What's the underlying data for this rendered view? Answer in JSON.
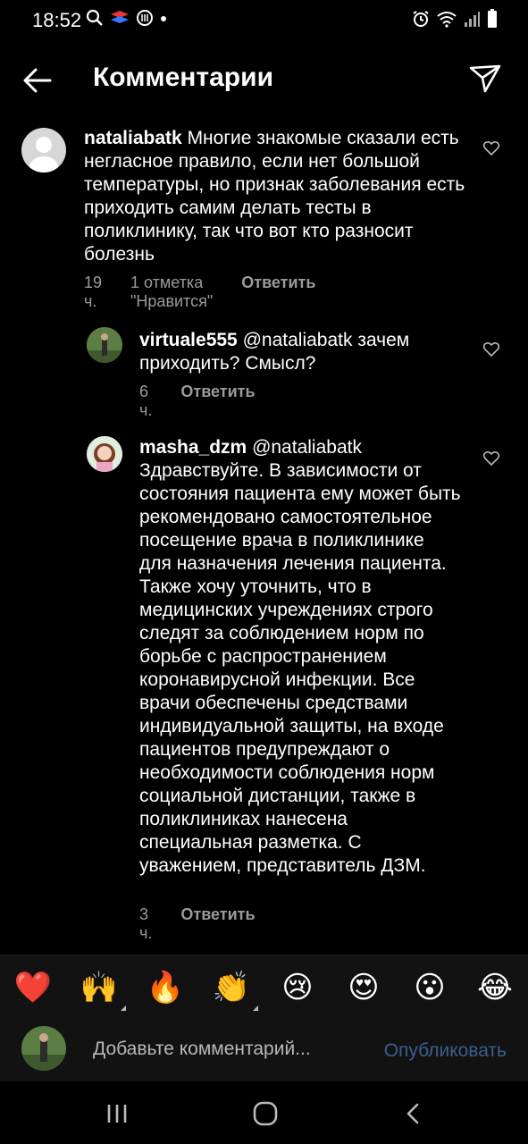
{
  "status": {
    "time": "18:52",
    "icons_left": [
      "search-icon",
      "flag-icon",
      "instagram-icon",
      "dot-icon"
    ],
    "icons_right": [
      "alarm-icon",
      "wifi-icon",
      "signal-icon",
      "battery-icon"
    ]
  },
  "header": {
    "title": "Комментарии",
    "back_icon": "arrow-left-icon",
    "send_icon": "paper-plane-icon"
  },
  "comments": [
    {
      "username": "nataliabatk",
      "text": "Многие знакомые сказали есть негласное правило, если нет большой температуры, но признак заболевания есть приходить самим делать тесты в поликлинику, так что вот кто разносит болезнь",
      "time": "19 ч.",
      "likes": "1 отметка \"Нравится\"",
      "reply": "Ответить"
    },
    {
      "username": "virtuale555",
      "text": "@nataliabatk зачем приходить? Смысл?",
      "time": "6 ч.",
      "reply": "Ответить"
    },
    {
      "username": "masha_dzm",
      "mention": "@nataliabatk",
      "text": "Здравствуйте. В зависимости от состояния пациента ему может быть рекомендовано самостоятельное посещение врача в поликлинике для назначения лечения пациента. Также хочу уточнить, что в медицинских учреждениях строго следят за соблюдением норм по борьбе с распространением коронавирусной инфекции. Все врачи обеспечены средствами индивидуальной защиты, на входе пациентов предупреждают о необходимости соблюдения норм социальной дистанции, также в поликлиниках нанесена специальная разметка. С уважением, представитель ДЗМ.",
      "time": "3 ч.",
      "reply": "Ответить"
    }
  ],
  "emojis": [
    "❤️",
    "🙌",
    "🔥",
    "👏",
    "😢",
    "😍",
    "😮",
    "😂"
  ],
  "add_comment": {
    "placeholder": "Добавьте комментарий...",
    "publish": "Опубликовать"
  },
  "colors": {
    "background": "#000000",
    "meta": "#9a9a9a",
    "publish": "#3c5e8e"
  }
}
